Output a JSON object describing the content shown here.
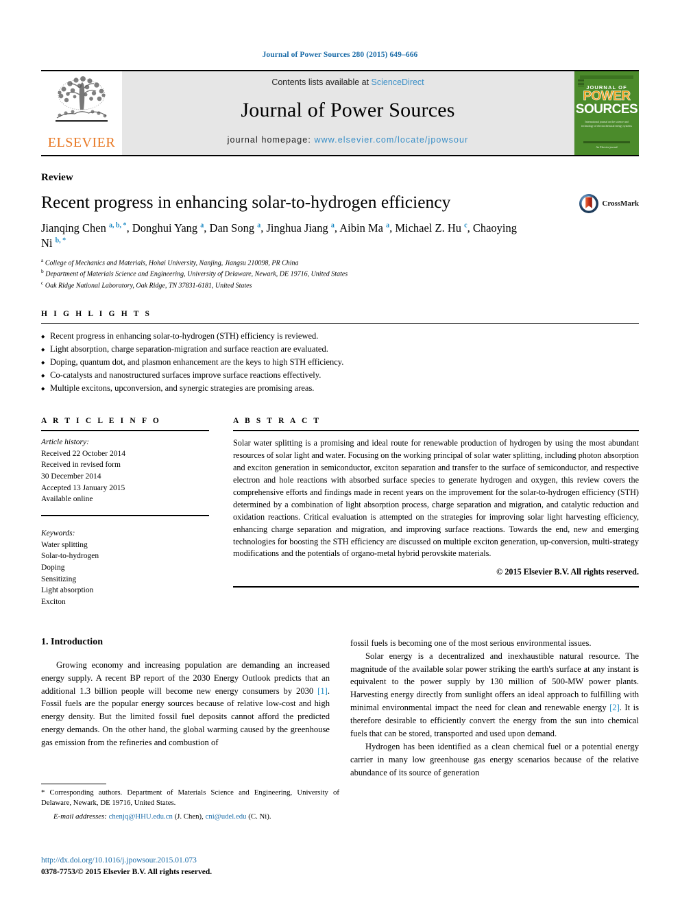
{
  "running_head": "Journal of Power Sources 280 (2015) 649–666",
  "masthead": {
    "publisher_name": "ELSEVIER",
    "contents_prefix": "Contents lists available at ",
    "contents_link": "ScienceDirect",
    "journal_name": "Journal of Power Sources",
    "homepage_prefix": "journal homepage: ",
    "homepage_link": "www.elsevier.com/locate/jpowsour",
    "cover": {
      "journal_of": "JOURNAL OF",
      "power": "POWER",
      "sources": "SOURCES",
      "blurb": "International journal on the science and technology of electrochemical energy systems",
      "foot": "An Elsevier journal"
    }
  },
  "article": {
    "doctype": "Review",
    "title": "Recent progress in enhancing solar-to-hydrogen efficiency",
    "crossmark_label": "CrossMark",
    "authors_html": "Jianqing Chen <sup>a, b, *</sup>, Donghui Yang <sup>a</sup>, Dan Song <sup>a</sup>, Jinghua Jiang <sup>a</sup>, Aibin Ma <sup>a</sup>, Michael Z. Hu <sup>c</sup>, Chaoying Ni <sup>b, *</sup>",
    "affiliations": [
      {
        "marker": "a",
        "text": "College of Mechanics and Materials, Hohai University, Nanjing, Jiangsu 210098, PR China"
      },
      {
        "marker": "b",
        "text": "Department of Materials Science and Engineering, University of Delaware, Newark, DE 19716, United States"
      },
      {
        "marker": "c",
        "text": "Oak Ridge National Laboratory, Oak Ridge, TN 37831-6181, United States"
      }
    ]
  },
  "highlights": {
    "heading": "H I G H L I G H T S",
    "items": [
      "Recent progress in enhancing solar-to-hydrogen (STH) efficiency is reviewed.",
      "Light absorption, charge separation-migration and surface reaction are evaluated.",
      "Doping, quantum dot, and plasmon enhancement are the keys to high STH efficiency.",
      "Co-catalysts and nanostructured surfaces improve surface reactions effectively.",
      "Multiple excitons, upconversion, and synergic strategies are promising areas."
    ]
  },
  "article_info": {
    "heading": "A R T I C L E   I N F O",
    "history_label": "Article history:",
    "history": [
      "Received 22 October 2014",
      "Received in revised form",
      "30 December 2014",
      "Accepted 13 January 2015",
      "Available online"
    ],
    "keywords_label": "Keywords:",
    "keywords": [
      "Water splitting",
      "Solar-to-hydrogen",
      "Doping",
      "Sensitizing",
      "Light absorption",
      "Exciton"
    ]
  },
  "abstract": {
    "heading": "A B S T R A C T",
    "text": "Solar water splitting is a promising and ideal route for renewable production of hydrogen by using the most abundant resources of solar light and water. Focusing on the working principal of solar water splitting, including photon absorption and exciton generation in semiconductor, exciton separation and transfer to the surface of semiconductor, and respective electron and hole reactions with absorbed surface species to generate hydrogen and oxygen, this review covers the comprehensive efforts and findings made in recent years on the improvement for the solar-to-hydrogen efficiency (STH) determined by a combination of light absorption process, charge separation and migration, and catalytic reduction and oxidation reactions. Critical evaluation is attempted on the strategies for improving solar light harvesting efficiency, enhancing charge separation and migration, and improving surface reactions. Towards the end, new and emerging technologies for boosting the STH efficiency are discussed on multiple exciton generation, up-conversion, multi-strategy modifications and the potentials of organo-metal hybrid perovskite materials.",
    "rights": "© 2015 Elsevier B.V. All rights reserved."
  },
  "body": {
    "section_title": "1. Introduction",
    "left_paragraph_html": "Growing economy and increasing population are demanding an increased energy supply. A recent BP report of the 2030 Energy Outlook predicts that an additional 1.3 billion people will become new energy consumers by 2030 <span class=\"ref\">[1]</span>. Fossil fuels are the popular energy sources because of relative low-cost and high energy density. But the limited fossil fuel deposits cannot afford the predicted energy demands. On the other hand, the global warming caused by the greenhouse gas emission from the refineries and combustion of",
    "right_paragraph_1_html": "fossil fuels is becoming one of the most serious environmental issues.",
    "right_paragraph_2_html": "Solar energy is a decentralized and inexhaustible natural resource. The magnitude of the available solar power striking the earth's surface at any instant is equivalent to the power supply by 130 million of 500-MW power plants. Harvesting energy directly from sunlight offers an ideal approach to fulfilling with minimal environmental impact the need for clean and renewable energy <span class=\"ref\">[2]</span>. It is therefore desirable to efficiently convert the energy from the sun into chemical fuels that can be stored, transported and used upon demand.",
    "right_paragraph_3_html": "Hydrogen has been identified as a clean chemical fuel or a potential energy carrier in many low greenhouse gas energy scenarios because of the relative abundance of its source of generation"
  },
  "footnotes": {
    "corresponding_html": "* Corresponding authors. Department of Materials Science and Engineering, University of Delaware, Newark, DE 19716, United States.",
    "email_label": "E-mail addresses:",
    "email_html": " <span class=\"link\">chenjq@HHU.edu.cn</span> (J. Chen), <span class=\"link\">cni@udel.edu</span> (C. Ni)."
  },
  "bottom": {
    "doi": "http://dx.doi.org/10.1016/j.jpowsour.2015.01.073",
    "issn_rights": "0378-7753/© 2015 Elsevier B.V. All rights reserved."
  },
  "colors": {
    "link_blue": "#1b6ca8",
    "sciencedirect_blue": "#3a8fc7",
    "elsevier_orange": "#E87722",
    "cover_green": "#4b8b2b",
    "ref_blue": "#1b8ac4"
  }
}
